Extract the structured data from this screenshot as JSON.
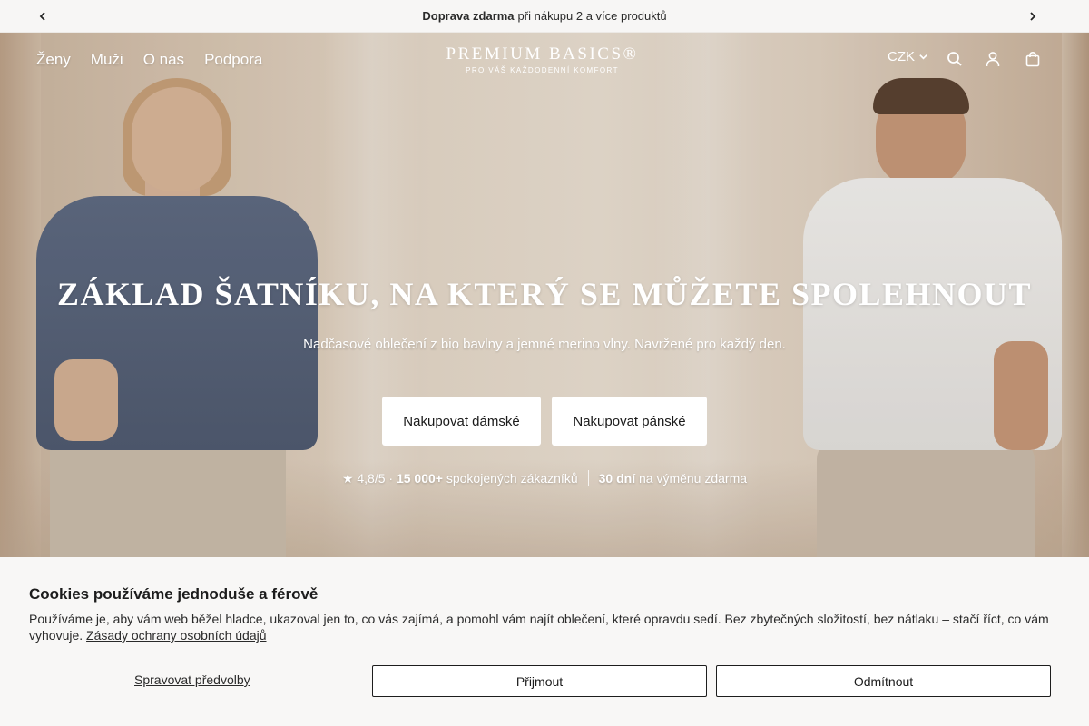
{
  "announcement": {
    "bold": "Doprava zdarma",
    "text": "při nákupu 2 a více produktů"
  },
  "nav": {
    "items": [
      "Ženy",
      "Muži",
      "O nás",
      "Podpora"
    ]
  },
  "logo": {
    "name": "PREMIUM BASICS®",
    "tagline": "PRO VÁŠ KAŽDODENNÍ KOMFORT"
  },
  "tools": {
    "currency": "CZK",
    "icons": [
      "search-icon",
      "account-icon",
      "bag-icon"
    ]
  },
  "hero": {
    "title": "ZÁKLAD ŠATNÍKU, NA KTERÝ SE MŮŽETE SPOLEHNOUT",
    "subtitle": "Nadčasové oblečení z bio bavlny a jemné merino vlny. Navržené pro každý den.",
    "button_women": "Nakupovat dámské",
    "button_men": "Nakupovat pánské",
    "trust": {
      "rating": "★ 4,8/5 ·",
      "customers_bold": "15 000+",
      "customers_text": "spokojených zákazníků",
      "days_bold": "30 dní",
      "days_text": "na výměnu zdarma"
    }
  },
  "cookie": {
    "title": "Cookies používáme jednoduše a férově",
    "text": "Používáme je, aby vám web běžel hladce, ukazoval jen to, co vás zajímá, a pomohl vám najít oblečení, které opravdu sedí. Bez zbytečných složitostí, bez nátlaku – stačí říct, co vám vyhovuje.",
    "policy_link": "Zásady ochrany osobních údajů",
    "manage": "Spravovat předvolby",
    "accept": "Přijmout",
    "reject": "Odmítnout"
  },
  "colors": {
    "shirt_women": "#56627a",
    "shirt_men": "#f2f1ef",
    "banner_bg": "#f8f7f6"
  }
}
